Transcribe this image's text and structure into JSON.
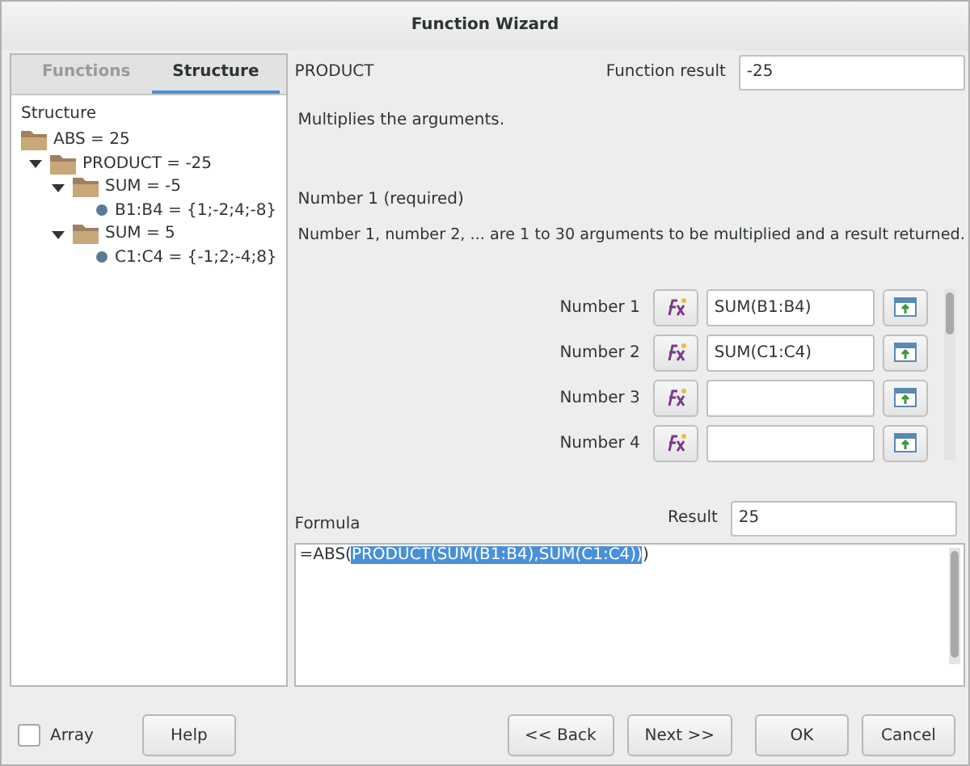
{
  "window": {
    "title": "Function Wizard"
  },
  "tabs": [
    {
      "label": "Functions",
      "selected": false
    },
    {
      "label": "Structure",
      "selected": true
    }
  ],
  "structure": {
    "label": "Structure",
    "tree": [
      {
        "kind": "folder",
        "label": "ABS = 25",
        "children": [
          {
            "kind": "folder",
            "label": "PRODUCT = -25",
            "expanded": true,
            "children": [
              {
                "kind": "folder",
                "label": "SUM = -5",
                "expanded": true,
                "children": [
                  {
                    "kind": "value",
                    "label": "B1:B4 = {1;-2;4;-8}"
                  }
                ]
              },
              {
                "kind": "folder",
                "label": "SUM = 5",
                "expanded": true,
                "children": [
                  {
                    "kind": "value",
                    "label": "C1:C4 = {-1;2;-4;8}"
                  }
                ]
              }
            ]
          }
        ]
      }
    ]
  },
  "function_name": "PRODUCT",
  "function_result": {
    "label": "Function result",
    "value": "-25"
  },
  "description": "Multiplies the arguments.",
  "argument_title": "Number 1 (required)",
  "argument_description": "Number 1, number 2, ... are 1 to 30 arguments to be multiplied and a result returned.",
  "arguments": [
    {
      "label": "Number 1",
      "value": "SUM(B1:B4)"
    },
    {
      "label": "Number 2",
      "value": "SUM(C1:C4)"
    },
    {
      "label": "Number 3"
    },
    {
      "label": "Number 4"
    }
  ],
  "formula": {
    "label": "Formula",
    "before": "=ABS(",
    "selected": "PRODUCT(SUM(B1:B4),SUM(C1:C4))",
    "after": ")"
  },
  "result": {
    "label": "Result",
    "value": "25"
  },
  "array": {
    "label": "Array",
    "checked": false
  },
  "buttons": {
    "help": "Help",
    "back": "<< Back",
    "next": "Next >>",
    "ok": "OK",
    "cancel": "Cancel"
  }
}
